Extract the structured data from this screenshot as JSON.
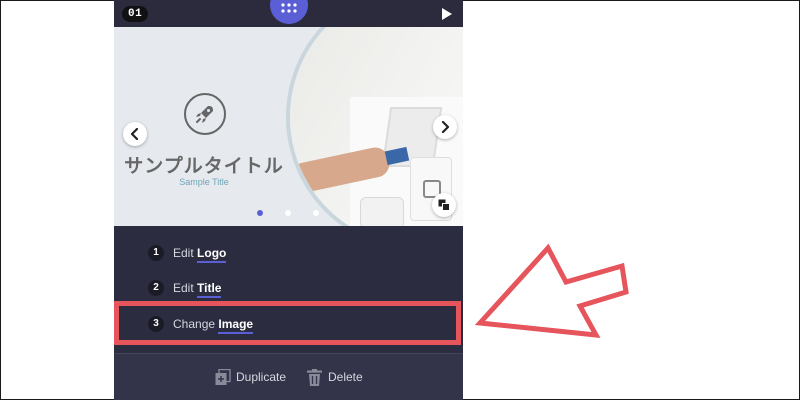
{
  "topbar": {
    "slide_number": "01",
    "grid_icon": "grid-dots-icon",
    "play_icon": "play-icon"
  },
  "slide": {
    "title_jp": "サンプルタイトル",
    "subtitle": "Sample Title",
    "logo_icon": "rocket-icon",
    "nav_prev_icon": "chevron-left-icon",
    "nav_next_icon": "chevron-right-icon",
    "duplicate_icon": "copy-icon",
    "pagination": {
      "count": 3,
      "active_index": 0
    }
  },
  "menu": {
    "items": [
      {
        "number": "1",
        "verb": "Edit",
        "target": "Logo"
      },
      {
        "number": "2",
        "verb": "Edit",
        "target": "Title"
      },
      {
        "number": "3",
        "verb": "Change",
        "target": "Image"
      }
    ]
  },
  "actions": {
    "duplicate_label": "Duplicate",
    "delete_label": "Delete"
  },
  "annotation": {
    "highlight_color": "#e6545c",
    "accent_color": "#5b5fd6"
  }
}
